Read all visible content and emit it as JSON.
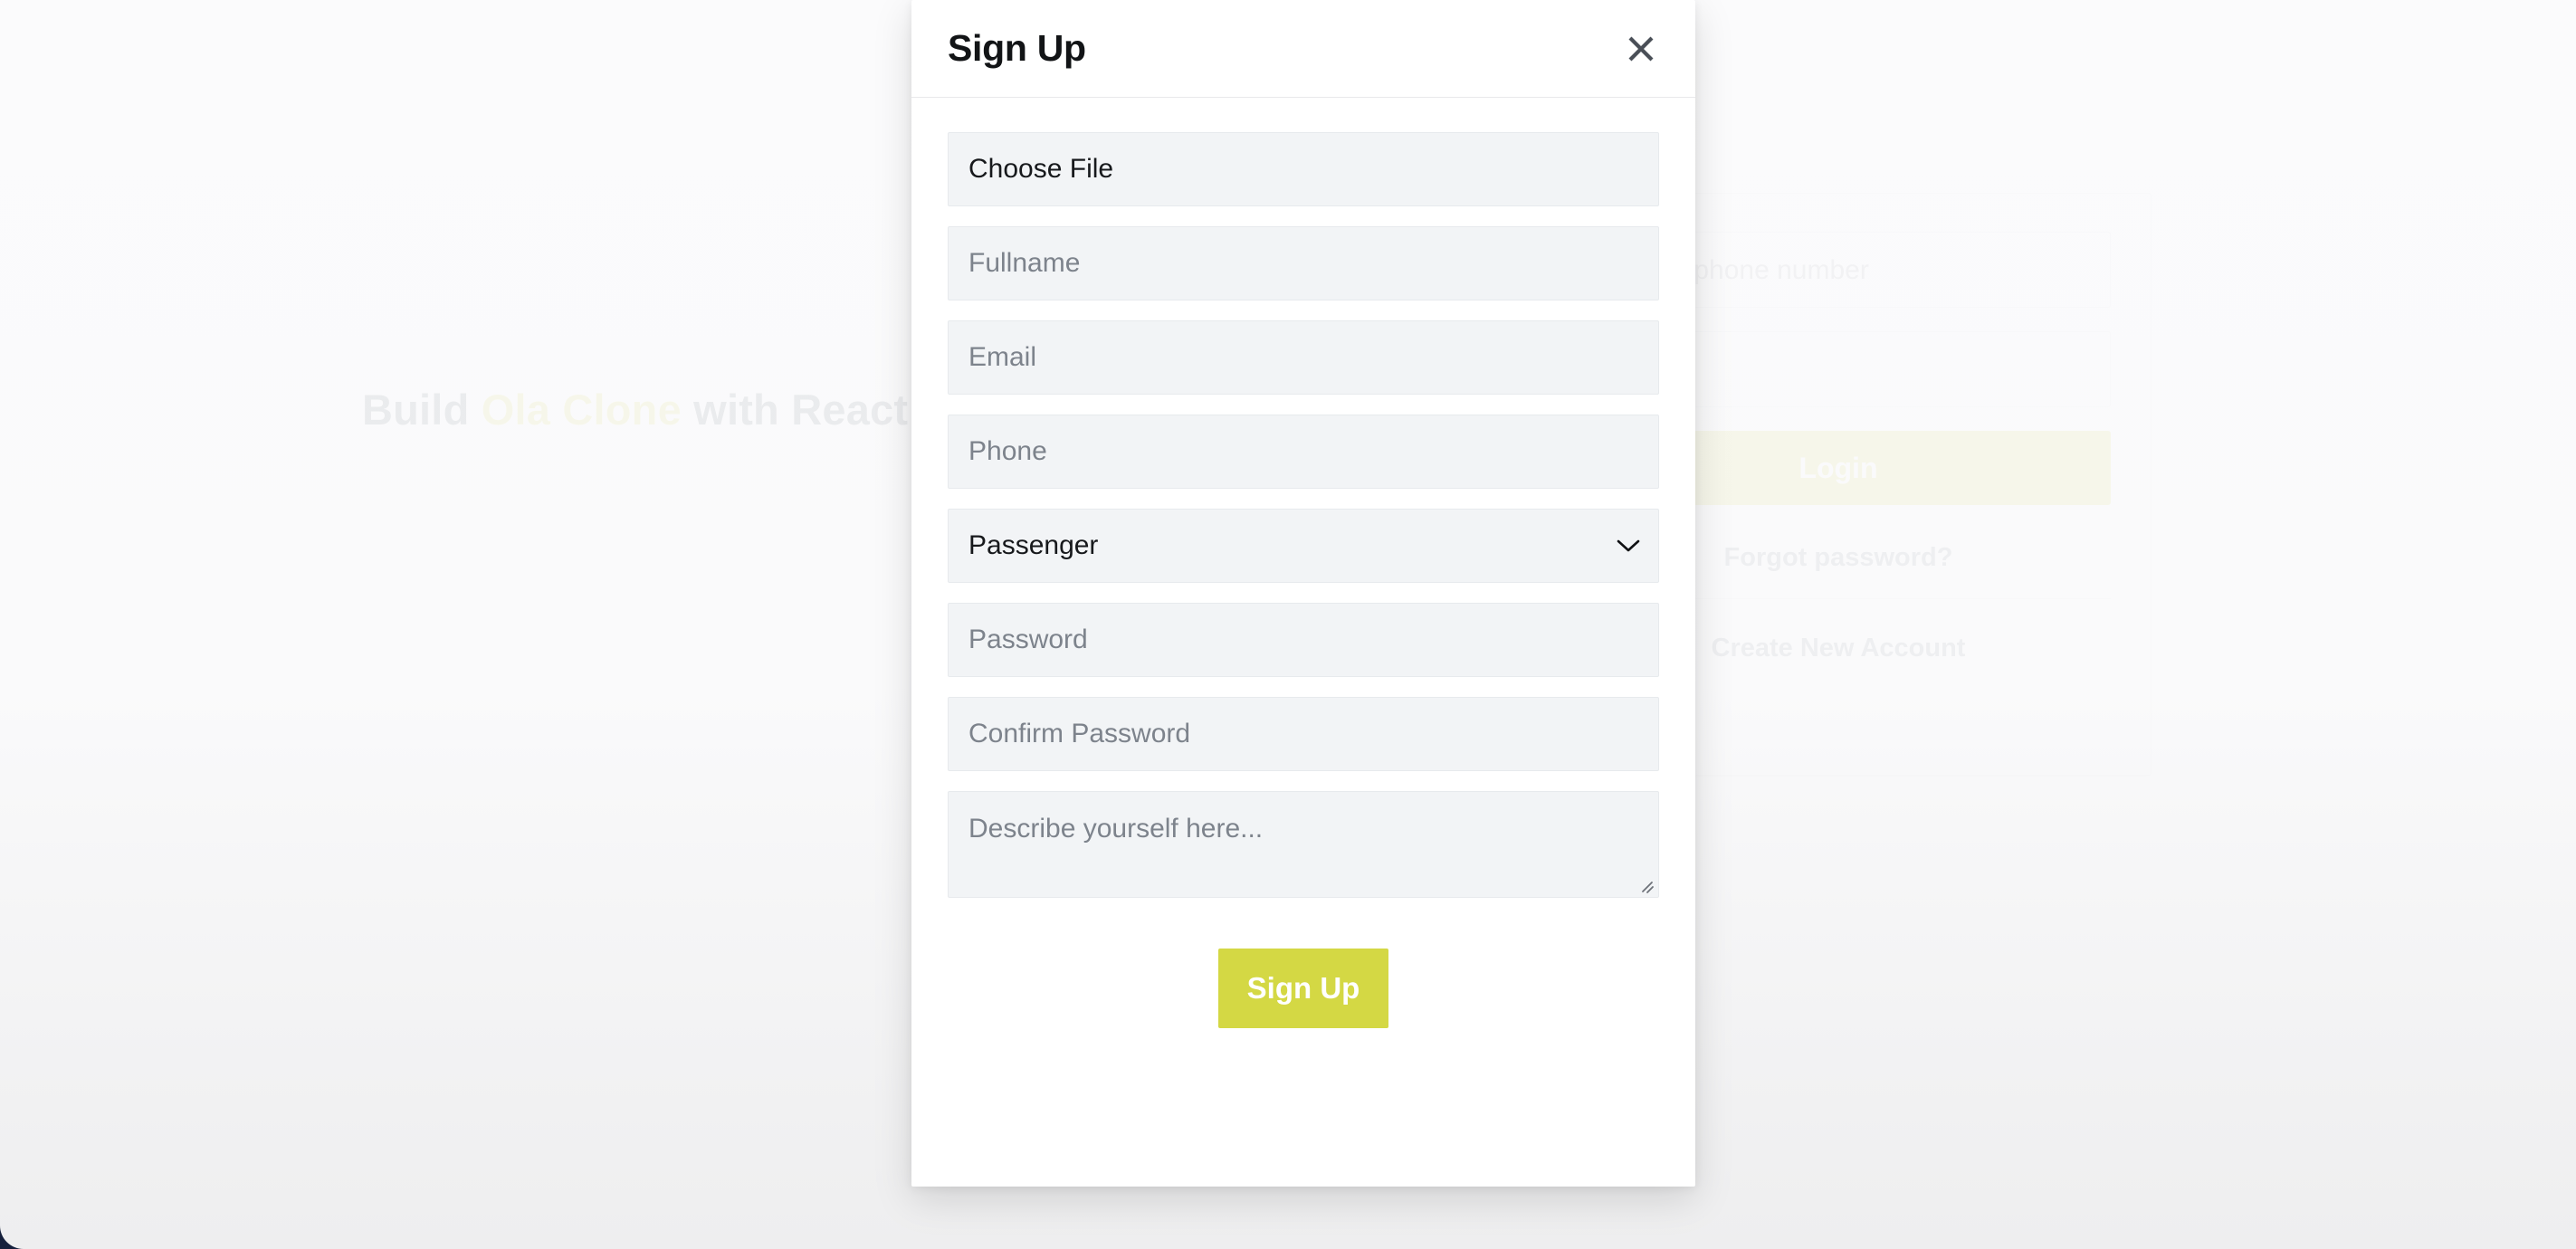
{
  "background": {
    "hero": {
      "prefix": "Build ",
      "brand": "Ola Clone",
      "suffix": " with React"
    },
    "login_card": {
      "identifier_placeholder": "Email or phone number",
      "password_placeholder": "",
      "login_label": "Login",
      "forgot_password_label": "Forgot password?",
      "create_account_label": "Create New Account"
    }
  },
  "modal": {
    "title": "Sign Up",
    "close_icon": "close-icon",
    "fields": {
      "file_label": "Choose File",
      "fullname_placeholder": "Fullname",
      "email_placeholder": "Email",
      "phone_placeholder": "Phone",
      "role_selected": "Passenger",
      "role_chevron_icon": "chevron-down-icon",
      "password_placeholder": "Password",
      "confirm_password_placeholder": "Confirm Password",
      "bio_placeholder": "Describe yourself here..."
    },
    "submit_label": "Sign Up"
  },
  "colors": {
    "accent": "#d4d844",
    "field_background": "#f2f4f6",
    "modal_background": "#ffffff",
    "placeholder_text": "#7d838c",
    "title_text": "#121416"
  }
}
